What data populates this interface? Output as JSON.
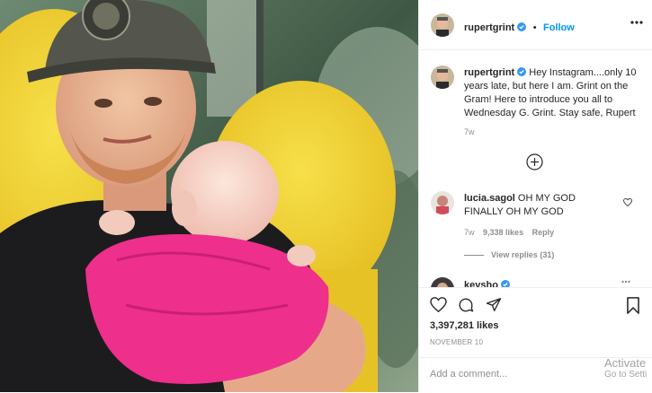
{
  "post": {
    "username": "rupertgrint",
    "follow_label": "Follow",
    "separator": "•",
    "caption_text": "Hey Instagram....only 10 years late, but here I am. Grint on the Gram! Here to introduce you all to Wednesday G. Grint. Stay safe, Rupert",
    "caption_age": "7w"
  },
  "comments": [
    {
      "username": "lucia.sagol",
      "text": "OH MY GOD FINALLY OH MY GOD",
      "age": "7w",
      "likes": "9,338 likes",
      "reply_label": "Reply",
      "view_replies": "View replies (31)"
    },
    {
      "username": "keysho"
    }
  ],
  "likes_count": "3,397,281 likes",
  "date": "NOVEMBER 10",
  "add_comment_placeholder": "Add a comment...",
  "watermark": {
    "line1": "Activate",
    "line2": "Go to Setti"
  },
  "icons": {
    "more": "more-options-icon",
    "load_more": "load-more-comments-icon",
    "heart": "heart-icon",
    "comment": "comment-icon",
    "share": "share-icon",
    "bookmark": "bookmark-icon",
    "verified": "verified-badge-icon"
  },
  "colors": {
    "accent": "#0095f6",
    "armchair": "#f2d135",
    "hoodie": "#ee2f8c",
    "text": "#262626",
    "muted": "#8e8e8e"
  }
}
